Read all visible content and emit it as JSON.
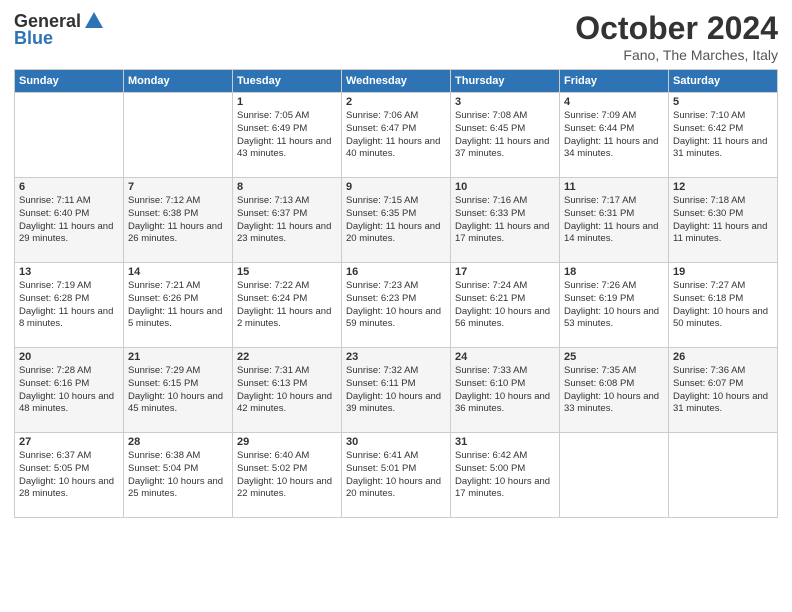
{
  "header": {
    "logo_general": "General",
    "logo_blue": "Blue",
    "title": "October 2024",
    "location": "Fano, The Marches, Italy"
  },
  "days_of_week": [
    "Sunday",
    "Monday",
    "Tuesday",
    "Wednesday",
    "Thursday",
    "Friday",
    "Saturday"
  ],
  "weeks": [
    [
      {
        "day": "",
        "sunrise": "",
        "sunset": "",
        "daylight": ""
      },
      {
        "day": "",
        "sunrise": "",
        "sunset": "",
        "daylight": ""
      },
      {
        "day": "1",
        "sunrise": "Sunrise: 7:05 AM",
        "sunset": "Sunset: 6:49 PM",
        "daylight": "Daylight: 11 hours and 43 minutes."
      },
      {
        "day": "2",
        "sunrise": "Sunrise: 7:06 AM",
        "sunset": "Sunset: 6:47 PM",
        "daylight": "Daylight: 11 hours and 40 minutes."
      },
      {
        "day": "3",
        "sunrise": "Sunrise: 7:08 AM",
        "sunset": "Sunset: 6:45 PM",
        "daylight": "Daylight: 11 hours and 37 minutes."
      },
      {
        "day": "4",
        "sunrise": "Sunrise: 7:09 AM",
        "sunset": "Sunset: 6:44 PM",
        "daylight": "Daylight: 11 hours and 34 minutes."
      },
      {
        "day": "5",
        "sunrise": "Sunrise: 7:10 AM",
        "sunset": "Sunset: 6:42 PM",
        "daylight": "Daylight: 11 hours and 31 minutes."
      }
    ],
    [
      {
        "day": "6",
        "sunrise": "Sunrise: 7:11 AM",
        "sunset": "Sunset: 6:40 PM",
        "daylight": "Daylight: 11 hours and 29 minutes."
      },
      {
        "day": "7",
        "sunrise": "Sunrise: 7:12 AM",
        "sunset": "Sunset: 6:38 PM",
        "daylight": "Daylight: 11 hours and 26 minutes."
      },
      {
        "day": "8",
        "sunrise": "Sunrise: 7:13 AM",
        "sunset": "Sunset: 6:37 PM",
        "daylight": "Daylight: 11 hours and 23 minutes."
      },
      {
        "day": "9",
        "sunrise": "Sunrise: 7:15 AM",
        "sunset": "Sunset: 6:35 PM",
        "daylight": "Daylight: 11 hours and 20 minutes."
      },
      {
        "day": "10",
        "sunrise": "Sunrise: 7:16 AM",
        "sunset": "Sunset: 6:33 PM",
        "daylight": "Daylight: 11 hours and 17 minutes."
      },
      {
        "day": "11",
        "sunrise": "Sunrise: 7:17 AM",
        "sunset": "Sunset: 6:31 PM",
        "daylight": "Daylight: 11 hours and 14 minutes."
      },
      {
        "day": "12",
        "sunrise": "Sunrise: 7:18 AM",
        "sunset": "Sunset: 6:30 PM",
        "daylight": "Daylight: 11 hours and 11 minutes."
      }
    ],
    [
      {
        "day": "13",
        "sunrise": "Sunrise: 7:19 AM",
        "sunset": "Sunset: 6:28 PM",
        "daylight": "Daylight: 11 hours and 8 minutes."
      },
      {
        "day": "14",
        "sunrise": "Sunrise: 7:21 AM",
        "sunset": "Sunset: 6:26 PM",
        "daylight": "Daylight: 11 hours and 5 minutes."
      },
      {
        "day": "15",
        "sunrise": "Sunrise: 7:22 AM",
        "sunset": "Sunset: 6:24 PM",
        "daylight": "Daylight: 11 hours and 2 minutes."
      },
      {
        "day": "16",
        "sunrise": "Sunrise: 7:23 AM",
        "sunset": "Sunset: 6:23 PM",
        "daylight": "Daylight: 10 hours and 59 minutes."
      },
      {
        "day": "17",
        "sunrise": "Sunrise: 7:24 AM",
        "sunset": "Sunset: 6:21 PM",
        "daylight": "Daylight: 10 hours and 56 minutes."
      },
      {
        "day": "18",
        "sunrise": "Sunrise: 7:26 AM",
        "sunset": "Sunset: 6:19 PM",
        "daylight": "Daylight: 10 hours and 53 minutes."
      },
      {
        "day": "19",
        "sunrise": "Sunrise: 7:27 AM",
        "sunset": "Sunset: 6:18 PM",
        "daylight": "Daylight: 10 hours and 50 minutes."
      }
    ],
    [
      {
        "day": "20",
        "sunrise": "Sunrise: 7:28 AM",
        "sunset": "Sunset: 6:16 PM",
        "daylight": "Daylight: 10 hours and 48 minutes."
      },
      {
        "day": "21",
        "sunrise": "Sunrise: 7:29 AM",
        "sunset": "Sunset: 6:15 PM",
        "daylight": "Daylight: 10 hours and 45 minutes."
      },
      {
        "day": "22",
        "sunrise": "Sunrise: 7:31 AM",
        "sunset": "Sunset: 6:13 PM",
        "daylight": "Daylight: 10 hours and 42 minutes."
      },
      {
        "day": "23",
        "sunrise": "Sunrise: 7:32 AM",
        "sunset": "Sunset: 6:11 PM",
        "daylight": "Daylight: 10 hours and 39 minutes."
      },
      {
        "day": "24",
        "sunrise": "Sunrise: 7:33 AM",
        "sunset": "Sunset: 6:10 PM",
        "daylight": "Daylight: 10 hours and 36 minutes."
      },
      {
        "day": "25",
        "sunrise": "Sunrise: 7:35 AM",
        "sunset": "Sunset: 6:08 PM",
        "daylight": "Daylight: 10 hours and 33 minutes."
      },
      {
        "day": "26",
        "sunrise": "Sunrise: 7:36 AM",
        "sunset": "Sunset: 6:07 PM",
        "daylight": "Daylight: 10 hours and 31 minutes."
      }
    ],
    [
      {
        "day": "27",
        "sunrise": "Sunrise: 6:37 AM",
        "sunset": "Sunset: 5:05 PM",
        "daylight": "Daylight: 10 hours and 28 minutes."
      },
      {
        "day": "28",
        "sunrise": "Sunrise: 6:38 AM",
        "sunset": "Sunset: 5:04 PM",
        "daylight": "Daylight: 10 hours and 25 minutes."
      },
      {
        "day": "29",
        "sunrise": "Sunrise: 6:40 AM",
        "sunset": "Sunset: 5:02 PM",
        "daylight": "Daylight: 10 hours and 22 minutes."
      },
      {
        "day": "30",
        "sunrise": "Sunrise: 6:41 AM",
        "sunset": "Sunset: 5:01 PM",
        "daylight": "Daylight: 10 hours and 20 minutes."
      },
      {
        "day": "31",
        "sunrise": "Sunrise: 6:42 AM",
        "sunset": "Sunset: 5:00 PM",
        "daylight": "Daylight: 10 hours and 17 minutes."
      },
      {
        "day": "",
        "sunrise": "",
        "sunset": "",
        "daylight": ""
      },
      {
        "day": "",
        "sunrise": "",
        "sunset": "",
        "daylight": ""
      }
    ]
  ]
}
